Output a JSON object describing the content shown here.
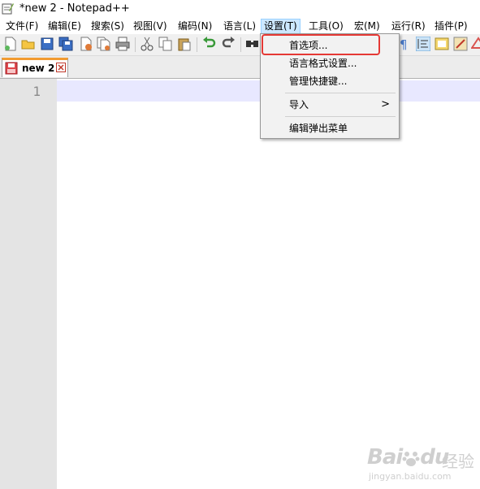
{
  "window": {
    "title": "*new 2 - Notepad++"
  },
  "menubar": {
    "items": [
      {
        "label": "文件(F)"
      },
      {
        "label": "编辑(E)"
      },
      {
        "label": "搜索(S)"
      },
      {
        "label": "视图(V)"
      },
      {
        "label": "编码(N)"
      },
      {
        "label": "语言(L)"
      },
      {
        "label": "设置(T)",
        "active": true
      },
      {
        "label": "工具(O)"
      },
      {
        "label": "宏(M)"
      },
      {
        "label": "运行(R)"
      },
      {
        "label": "插件(P)"
      }
    ]
  },
  "toolbar": {
    "icons": [
      "new-file-icon",
      "open-file-icon",
      "save-icon",
      "save-all-icon",
      "close-icon",
      "close-all-icon",
      "print-icon",
      "cut-icon",
      "copy-icon",
      "paste-icon",
      "undo-icon",
      "redo-icon",
      "find-icon",
      "show-all-chars-icon",
      "indent-guide-icon",
      "doc-map-icon",
      "function-list-icon",
      "folder-as-workspace-icon"
    ]
  },
  "tabs": [
    {
      "label": "new 2",
      "modified": true
    }
  ],
  "editor": {
    "line_numbers": [
      "1"
    ]
  },
  "settings_menu": {
    "items": [
      {
        "label": "首选项...",
        "highlighted": true
      },
      {
        "label": "语言格式设置..."
      },
      {
        "label": "管理快捷键..."
      },
      {
        "label": "导入",
        "submenu_arrow": ">"
      },
      {
        "label": "编辑弹出菜单"
      }
    ]
  },
  "watermark": {
    "brand": "Bai",
    "brand2": "du",
    "cn": "经验",
    "url": "jingyan.baidu.com"
  },
  "colors": {
    "highlight_border": "#e53935",
    "tab_accent": "#f29b30",
    "current_line": "#e8e8ff",
    "gutter": "#e4e4e4"
  }
}
